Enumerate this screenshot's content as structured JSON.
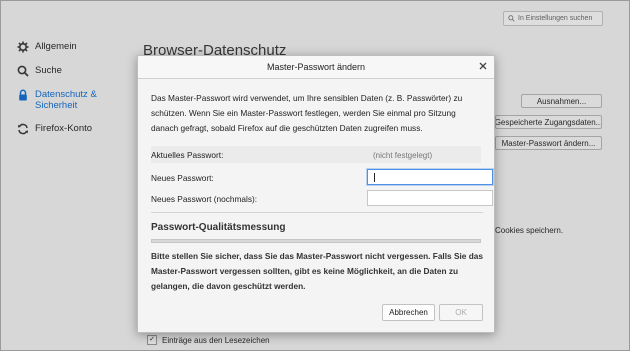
{
  "search": {
    "placeholder": "In Einstellungen suchen"
  },
  "sidebar": {
    "items": [
      {
        "label": "Allgemein",
        "icon": "gear-icon",
        "active": false
      },
      {
        "label": "Suche",
        "icon": "search-icon",
        "active": false
      },
      {
        "label": "Datenschutz &\nSicherheit",
        "icon": "lock-icon",
        "active": true
      },
      {
        "label": "Firefox-Konto",
        "icon": "sync-icon",
        "active": false
      }
    ]
  },
  "page": {
    "title": "Browser-Datenschutz",
    "exceptions_button": "Ausnahmen...",
    "saved_logins_button": "Gespeicherte Zugangsdaten...",
    "change_master_button": "Master-Passwort ändern...",
    "cookies_text": "Cookies speichern.",
    "bookmarks_checkbox": "Einträge aus den Lesezeichen"
  },
  "dialog": {
    "title": "Master-Passwort ändern",
    "intro": "Das Master-Passwort wird verwendet, um Ihre sensiblen Daten (z. B. Passwörter) zu schützen. Wenn Sie ein Master-Passwort festlegen, werden Sie einmal pro Sitzung danach gefragt, sobald Firefox auf die geschützten Daten zugreifen muss.",
    "current_label": "Aktuelles Passwort:",
    "current_value": "(nicht festgelegt)",
    "new_label": "Neues Passwort:",
    "repeat_label": "Neues Passwort (nochmals):",
    "quality_title": "Passwort-Qualitätsmessung",
    "quality_level": 0,
    "warning": "Bitte stellen Sie sicher, dass Sie das Master-Passwort nicht vergessen. Falls Sie das Master-Passwort vergessen sollten, gibt es keine Möglichkeit, an die Daten zu gelangen, die davon geschützt werden.",
    "cancel_label": "Abbrechen",
    "ok_label": "OK"
  }
}
